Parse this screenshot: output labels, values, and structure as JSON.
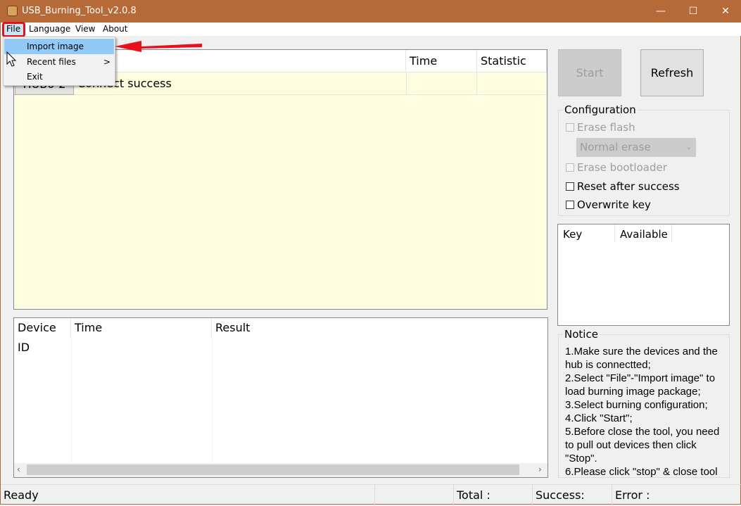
{
  "window": {
    "title": "USB_Burning_Tool_v2.0.8",
    "minimize": "—",
    "maximize": "☐",
    "close": "✕"
  },
  "menubar": {
    "items": [
      "File",
      "Language",
      "View",
      "About"
    ]
  },
  "file_menu": {
    "items": [
      {
        "label": "Import image",
        "highlighted": true
      },
      {
        "label": "Recent files",
        "submenu": true
      },
      {
        "label": "Exit"
      }
    ],
    "submenu_arrow": ">"
  },
  "device_table": {
    "columns": [
      "",
      "",
      "Time",
      "Statistic"
    ],
    "rows": [
      {
        "hub": "HUB0-2",
        "status": "Connect success",
        "time": "",
        "statistic": ""
      }
    ]
  },
  "log_table": {
    "columns": [
      "Device ID",
      "Time",
      "Result"
    ],
    "rows": []
  },
  "buttons": {
    "start": "Start",
    "refresh": "Refresh"
  },
  "configuration": {
    "title": "Configuration",
    "erase_flash": "Erase flash",
    "erase_mode": "Normal erase",
    "erase_bootloader": "Erase bootloader",
    "reset_after_success": "Reset after success",
    "overwrite_key": "Overwrite key"
  },
  "key_table": {
    "columns": [
      "Key",
      "Available"
    ]
  },
  "notice": {
    "title": "Notice",
    "lines": [
      "1.Make sure the devices and the hub is connectted;",
      "2.Select \"File\"-\"Import image\" to load burning image package;",
      "3.Select burning configuration;",
      "4.Click \"Start\";",
      "5.Before close the tool, you need to pull out devices then click \"Stop\".",
      "6.Please click \"stop\" & close tool"
    ]
  },
  "statusbar": {
    "state": "Ready",
    "total": "Total :",
    "success": "Success:",
    "error": "Error :"
  },
  "colors": {
    "titlebar": "#b66a37",
    "annotation": "#e8101a",
    "menu_highlight": "#91c9f7",
    "table_bg": "#fffde0"
  }
}
